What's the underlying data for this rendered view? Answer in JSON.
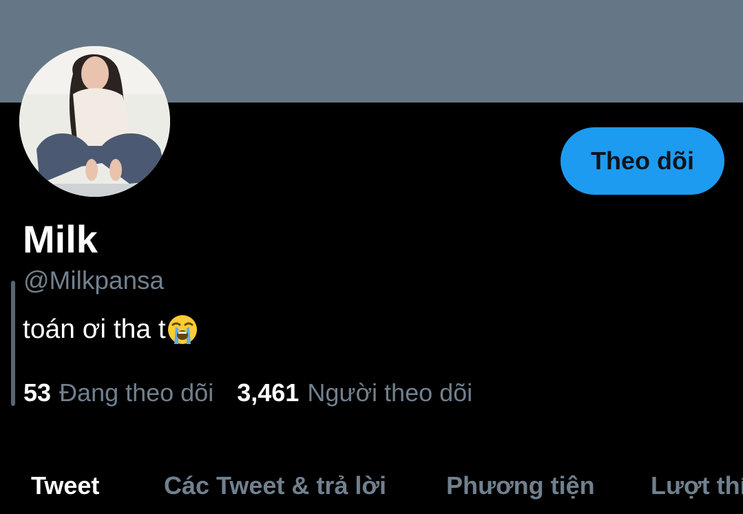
{
  "profile": {
    "display_name": "Milk",
    "handle": "@Milkpansa",
    "bio": "toán ơi tha t",
    "bio_emoji": "loudly-crying-face-emoji"
  },
  "actions": {
    "follow_label": "Theo dõi"
  },
  "stats": {
    "following_count": "53",
    "following_label": "Đang theo dõi",
    "followers_count": "3,461",
    "followers_label": "Người theo dõi"
  },
  "tabs": [
    {
      "label": "Tweet",
      "active": true
    },
    {
      "label": "Các Tweet & trả lời",
      "active": false
    },
    {
      "label": "Phương tiện",
      "active": false
    },
    {
      "label": "Lượt thích",
      "active": false
    }
  ],
  "colors": {
    "banner": "#657786",
    "background": "#000000",
    "accent": "#1d9bf0",
    "secondary_text": "#71808e",
    "primary_text": "#ffffff"
  }
}
